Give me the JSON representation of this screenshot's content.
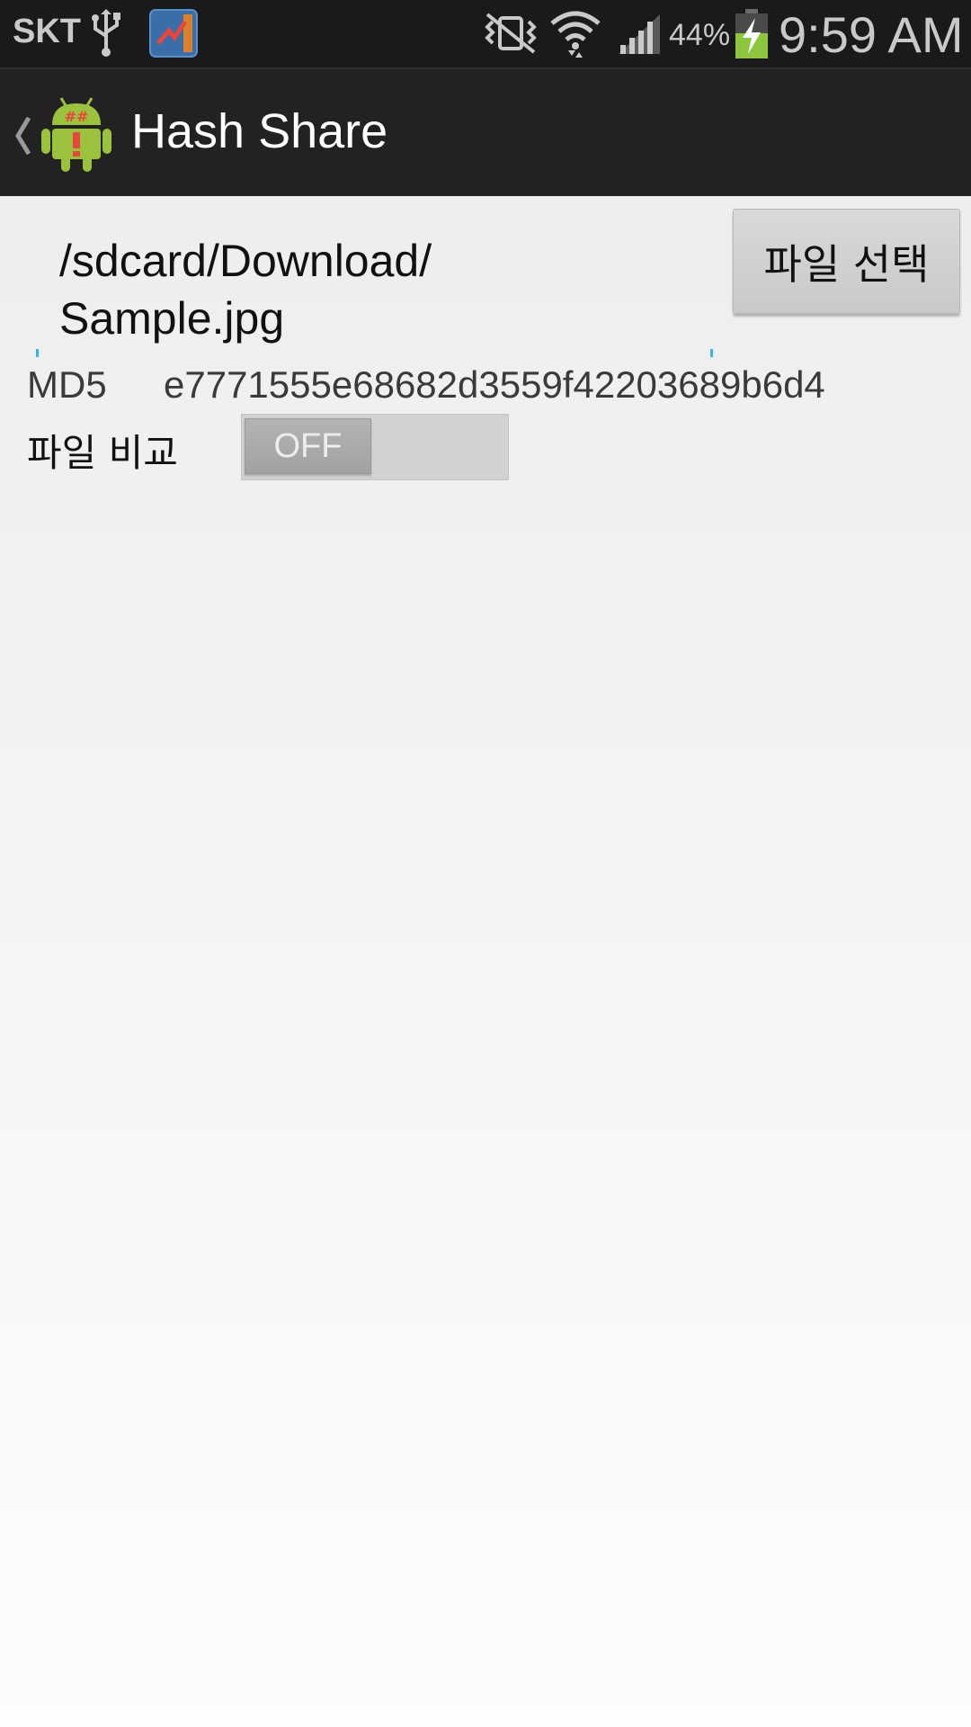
{
  "status_bar": {
    "carrier": "SKT",
    "battery_percent": "44%",
    "time": "9:59 AM",
    "icons": [
      "usb-icon",
      "app-notification-icon",
      "vibrate-icon",
      "wifi-icon",
      "signal-icon",
      "battery-charging-icon"
    ]
  },
  "action_bar": {
    "title": "Hash Share",
    "up_icon": "chevron-left-icon",
    "app_icon": "android-hash-icon"
  },
  "file": {
    "path_line1": "/sdcard/Download/",
    "path_line2": "Sample.jpg",
    "select_button_label": "파일 선택"
  },
  "hash": {
    "algorithm": "MD5",
    "value": "e7771555e68682d3559f42203689b6d4"
  },
  "compare": {
    "label": "파일 비교",
    "switch_state": "OFF"
  },
  "colors": {
    "accent": "#33b5e5",
    "status_bar_bg": "#1a1a1a",
    "action_bar_bg": "#222222",
    "android_green": "#9bc23c",
    "hash_red": "#e8453c"
  }
}
